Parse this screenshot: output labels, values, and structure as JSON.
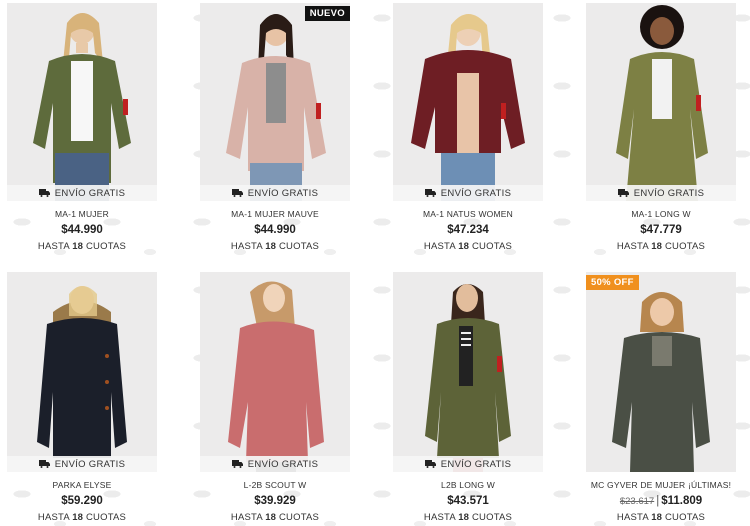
{
  "shipping_label": "ENVÍO GRATIS",
  "installments": {
    "prefix": "HASTA",
    "count": "18",
    "suffix": "CUOTAS"
  },
  "products": [
    {
      "name": "MA-1 MUJER",
      "price": "$44.990",
      "jacket_color": "#5e6b3c",
      "badge": ""
    },
    {
      "name": "MA-1 MUJER MAUVE",
      "price": "$44.990",
      "jacket_color": "#d8b2a8",
      "badge": "NUEVO"
    },
    {
      "name": "MA-1 NATUS WOMEN",
      "price": "$47.234",
      "jacket_color": "#6e1e24",
      "badge": ""
    },
    {
      "name": "MA-1 LONG W",
      "price": "$47.779",
      "jacket_color": "#7d8044",
      "badge": ""
    },
    {
      "name": "PARKA ELYSE",
      "price": "$59.290",
      "jacket_color": "#1b1f2a",
      "badge": ""
    },
    {
      "name": "L-2B SCOUT W",
      "price": "$39.929",
      "jacket_color": "#c96d6e",
      "badge": ""
    },
    {
      "name": "L2B LONG W",
      "price": "$43.571",
      "jacket_color": "#5d6338",
      "badge": ""
    },
    {
      "name": "MC GYVER DE MUJER ¡ÚLTIMAS!",
      "price": "$11.809",
      "old_price": "$23.617",
      "jacket_color": "#4a4f45",
      "badge": "50% OFF"
    }
  ]
}
